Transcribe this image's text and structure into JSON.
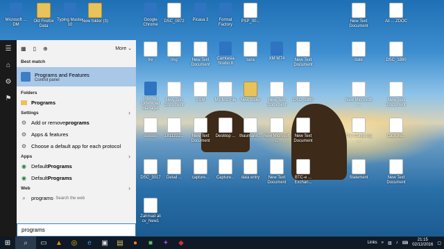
{
  "desktop_icons": [
    {
      "label": "Microsoft ... DM",
      "type": "app"
    },
    {
      "label": "Old Firefox Data",
      "type": "folder"
    },
    {
      "label": "Typing Master 10",
      "type": "app"
    },
    {
      "label": "New folder (3)",
      "type": "folder"
    },
    {
      "label": "Google Chrome",
      "type": "app"
    },
    {
      "label": "DSC_0872",
      "type": "doc"
    },
    {
      "label": "Picasa 3",
      "type": "app"
    },
    {
      "label": "Format Factory",
      "type": "app"
    },
    {
      "label": "PSP_00...",
      "type": "doc"
    },
    {
      "label": "New Text Document",
      "type": "doc"
    },
    {
      "label": "Ali ... ZDOC",
      "type": "doc"
    },
    {
      "label": "tre",
      "type": "doc"
    },
    {
      "label": "img",
      "type": "doc"
    },
    {
      "label": "New Text Document",
      "type": "doc"
    },
    {
      "label": "Camtasia Studio 8",
      "type": "app"
    },
    {
      "label": "sara",
      "type": "doc"
    },
    {
      "label": "XM MT4",
      "type": "app"
    },
    {
      "label": "New Text Document",
      "type": "doc"
    },
    {
      "label": "date",
      "type": "doc"
    },
    {
      "label": "DSC_1880",
      "type": "doc"
    },
    {
      "label": "Internet Download Manager",
      "type": "app"
    },
    {
      "label": "New Text Document",
      "type": "doc"
    },
    {
      "label": "SSM",
      "type": "doc"
    },
    {
      "label": "My first File",
      "type": "doc"
    },
    {
      "label": "New folder",
      "type": "folder"
    },
    {
      "label": "New Text Document",
      "type": "doc"
    },
    {
      "label": "DSC_1880",
      "type": "doc"
    },
    {
      "label": "New Microsoft ...",
      "type": "doc"
    },
    {
      "label": "New Text Document",
      "type": "doc"
    },
    {
      "label": "ssssss",
      "type": "doc"
    },
    {
      "label": "1811222...",
      "type": "doc"
    },
    {
      "label": "New Text Document",
      "type": "doc"
    },
    {
      "label": "Desktop ...",
      "type": "doc"
    },
    {
      "label": "thaumarin...",
      "type": "doc"
    },
    {
      "label": "New Microsoft ...",
      "type": "doc"
    },
    {
      "label": "New Text Document",
      "type": "doc"
    },
    {
      "label": "The Conjuring ...",
      "type": "doc"
    },
    {
      "label": "Capture...",
      "type": "doc"
    },
    {
      "label": "DSC_3017",
      "type": "doc"
    },
    {
      "label": "Detail ...",
      "type": "doc"
    },
    {
      "label": "capture...",
      "type": "doc"
    },
    {
      "label": "Capture...",
      "type": "doc"
    },
    {
      "label": "data entry",
      "type": "doc"
    },
    {
      "label": "New Text Document",
      "type": "doc"
    },
    {
      "label": "BTC-e ... Exchan...",
      "type": "doc"
    },
    {
      "label": "Statement",
      "type": "doc"
    },
    {
      "label": "New Text Document",
      "type": "doc"
    },
    {
      "label": "Zahmad ali cv_New1",
      "type": "doc"
    }
  ],
  "start_menu": {
    "toolbar": {
      "more_label": "More"
    },
    "best_match": {
      "heading": "Best match",
      "title": "Programs and Features",
      "subtitle": "Control panel"
    },
    "folders": {
      "heading": "Folders",
      "items": [
        {
          "label": "Programs"
        }
      ]
    },
    "settings": {
      "heading": "Settings",
      "items": [
        {
          "prefix": "Add or remove ",
          "bold": "programs"
        },
        {
          "prefix": "Apps & features",
          "bold": ""
        },
        {
          "prefix": "Choose a default app for each protocol",
          "bold": ""
        }
      ]
    },
    "apps": {
      "heading": "Apps",
      "items": [
        {
          "prefix": "Default ",
          "bold": "Programs"
        },
        {
          "prefix": "Default ",
          "bold": "Programs"
        }
      ]
    },
    "web": {
      "heading": "Web",
      "query": "programs",
      "hint": " - Search the web"
    },
    "search_value": "programs"
  },
  "taskbar": {
    "links_label": "Links",
    "time": "21:15",
    "date": "02/12/2016"
  }
}
